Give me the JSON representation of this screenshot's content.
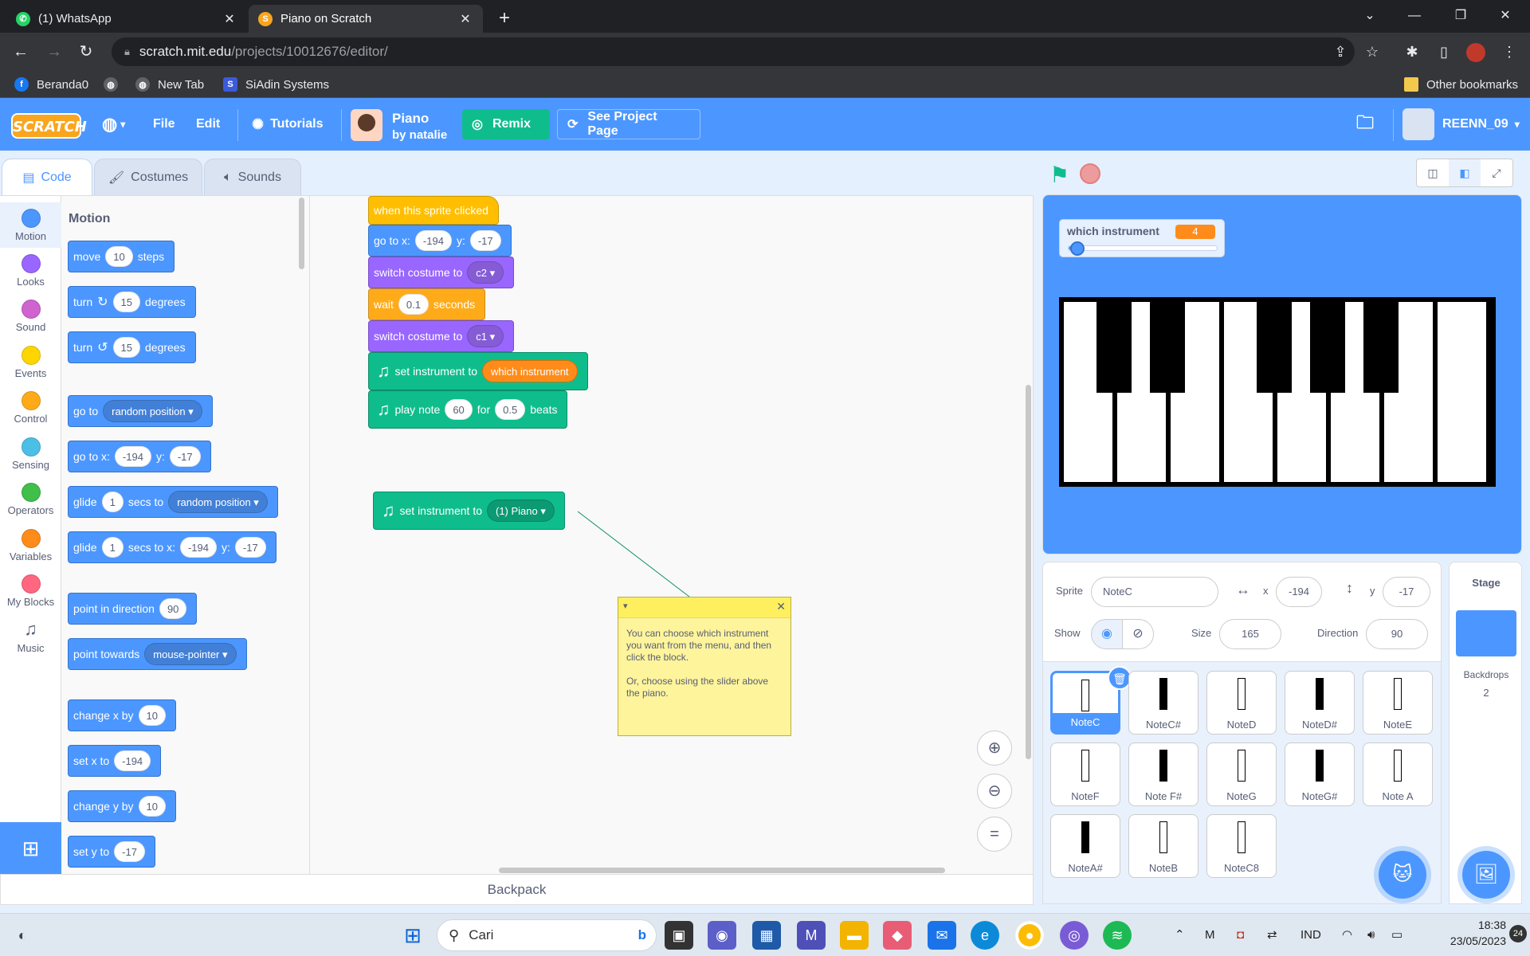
{
  "browser": {
    "tabs": [
      {
        "title": "(1) WhatsApp",
        "active": false,
        "icon": "whatsapp-icon"
      },
      {
        "title": "Piano on Scratch",
        "active": true,
        "icon": "scratch-icon"
      }
    ],
    "url_host": "scratch.mit.edu",
    "url_path": "/projects/10012676/editor/",
    "bookmarks": [
      "Beranda0",
      "New Tab",
      "SiAdin Systems"
    ],
    "other_bookmarks": "Other bookmarks"
  },
  "menubar": {
    "logo": "SCRATCH",
    "file": "File",
    "edit": "Edit",
    "tutorials": "Tutorials",
    "project_title": "Piano",
    "project_author": "by natalie",
    "remix": "Remix",
    "see_project_page": "See Project Page",
    "username": "REENN_09"
  },
  "editor_tabs": {
    "code": "Code",
    "costumes": "Costumes",
    "sounds": "Sounds"
  },
  "categories": [
    {
      "label": "Motion",
      "color": "#4c97ff"
    },
    {
      "label": "Looks",
      "color": "#9966ff"
    },
    {
      "label": "Sound",
      "color": "#cf63cf"
    },
    {
      "label": "Events",
      "color": "#ffd500"
    },
    {
      "label": "Control",
      "color": "#ffab19"
    },
    {
      "label": "Sensing",
      "color": "#4cbfe6"
    },
    {
      "label": "Operators",
      "color": "#40bf4a"
    },
    {
      "label": "Variables",
      "color": "#ff8c1a"
    },
    {
      "label": "My Blocks",
      "color": "#ff6680"
    },
    {
      "label": "Music",
      "color": ""
    }
  ],
  "palette": {
    "title": "Motion",
    "move": {
      "a": "move",
      "v": "10",
      "b": "steps"
    },
    "turn_cw": {
      "a": "turn",
      "v": "15",
      "b": "degrees"
    },
    "turn_ccw": {
      "a": "turn",
      "v": "15",
      "b": "degrees"
    },
    "goto": {
      "a": "go to",
      "dd": "random position"
    },
    "gotoxy": {
      "a": "go to x:",
      "x": "-194",
      "y_lbl": "y:",
      "y": "-17"
    },
    "glide": {
      "a": "glide",
      "v": "1",
      "b": "secs to",
      "dd": "random position"
    },
    "glidexy": {
      "a": "glide",
      "v": "1",
      "b": "secs to x:",
      "x": "-194",
      "y_lbl": "y:",
      "y": "-17"
    },
    "point_dir": {
      "a": "point in direction",
      "v": "90"
    },
    "point_towards": {
      "a": "point towards",
      "dd": "mouse-pointer"
    },
    "change_x": {
      "a": "change x by",
      "v": "10"
    },
    "set_x": {
      "a": "set x to",
      "v": "-194"
    },
    "change_y": {
      "a": "change y by",
      "v": "10"
    },
    "set_y": {
      "a": "set y to",
      "v": "-17"
    }
  },
  "script": {
    "hat": "when this sprite clicked",
    "goto": {
      "a": "go to x:",
      "x": "-194",
      "y_lbl": "y:",
      "y": "-17"
    },
    "switch1": {
      "a": "switch costume to",
      "dd": "c2"
    },
    "wait": {
      "a": "wait",
      "v": "0.1",
      "b": "seconds"
    },
    "switch2": {
      "a": "switch costume to",
      "dd": "c1"
    },
    "set_instr": {
      "a": "set instrument to",
      "rep": "which instrument"
    },
    "play_note": {
      "a": "play note",
      "v": "60",
      "b": "for",
      "v2": "0.5",
      "c": "beats"
    },
    "loose_set_instr": {
      "a": "set instrument to",
      "dd": "(1) Piano"
    },
    "comment": "You can choose which instrument you want from the menu, and then click the block.\n\nOr, choose using the slider above the piano."
  },
  "backpack": "Backpack",
  "stage": {
    "monitor_label": "which instrument",
    "monitor_value": "4",
    "slider_fraction": 0.03
  },
  "sprite_info": {
    "sprite_label": "Sprite",
    "sprite_name": "NoteC",
    "x_label": "x",
    "x": "-194",
    "y_label": "y",
    "y": "-17",
    "show_label": "Show",
    "size_label": "Size",
    "size": "165",
    "direction_label": "Direction",
    "direction": "90"
  },
  "sprites": [
    {
      "name": "NoteC",
      "key": "white",
      "selected": true
    },
    {
      "name": "NoteC#",
      "key": "black"
    },
    {
      "name": "NoteD",
      "key": "white"
    },
    {
      "name": "NoteD#",
      "key": "black"
    },
    {
      "name": "NoteE",
      "key": "white"
    },
    {
      "name": "NoteF",
      "key": "white"
    },
    {
      "name": "Note F#",
      "key": "black"
    },
    {
      "name": "NoteG",
      "key": "white"
    },
    {
      "name": "NoteG#",
      "key": "black"
    },
    {
      "name": "Note A",
      "key": "white"
    },
    {
      "name": "NoteA#",
      "key": "black"
    },
    {
      "name": "NoteB",
      "key": "white"
    },
    {
      "name": "NoteC8",
      "key": "white"
    }
  ],
  "stage_panel": {
    "title": "Stage",
    "backdrops_label": "Backdrops",
    "backdrops_count": "2"
  },
  "taskbar": {
    "search": "Cari",
    "lang": "IND",
    "time": "18:38",
    "date": "23/05/2023",
    "badge": "24"
  },
  "colors": {
    "scratch_blue": "#4c97ff",
    "music_green": "#0fbd8c"
  }
}
